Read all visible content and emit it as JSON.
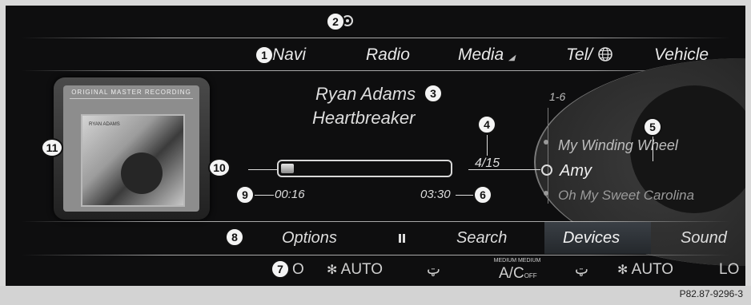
{
  "menu": {
    "items": [
      "Navi",
      "Radio",
      "Media",
      "Tel/",
      "Vehicle"
    ]
  },
  "media": {
    "artist": "Ryan Adams",
    "album": "Heartbreaker",
    "track_counter": "4/15",
    "elapsed": "00:16",
    "duration": "03:30",
    "progress": 0.076
  },
  "album_art": {
    "label_top": "ORIGINAL MASTER RECORDING",
    "artist_name": "RYAN ADAMS"
  },
  "tracklist": {
    "range": "1-6",
    "items": [
      "My Winding Wheel",
      "Amy",
      "Oh My Sweet Carolina"
    ],
    "selected_index": 1
  },
  "options_bar": {
    "options": "Options",
    "pause_icon": "pause-icon",
    "search": "Search",
    "devices": "Devices",
    "sound": "Sound",
    "active": "Devices"
  },
  "climate": {
    "left_temp": "O",
    "fan_left": "AUTO",
    "airflow_mode_label": "MEDIUM MEDIUM",
    "ac": "A/C",
    "ac_state": "OFF",
    "fan_right": "AUTO",
    "right_temp": "LO"
  },
  "callouts": [
    "1",
    "2",
    "3",
    "4",
    "5",
    "6",
    "7",
    "8",
    "9",
    "10",
    "11"
  ],
  "figure_code": "P82.87-9296-3",
  "colors": {
    "screen_bg": "#0e0e0f",
    "text": "#e8e8e8",
    "active_tab": "#2b2f34"
  }
}
